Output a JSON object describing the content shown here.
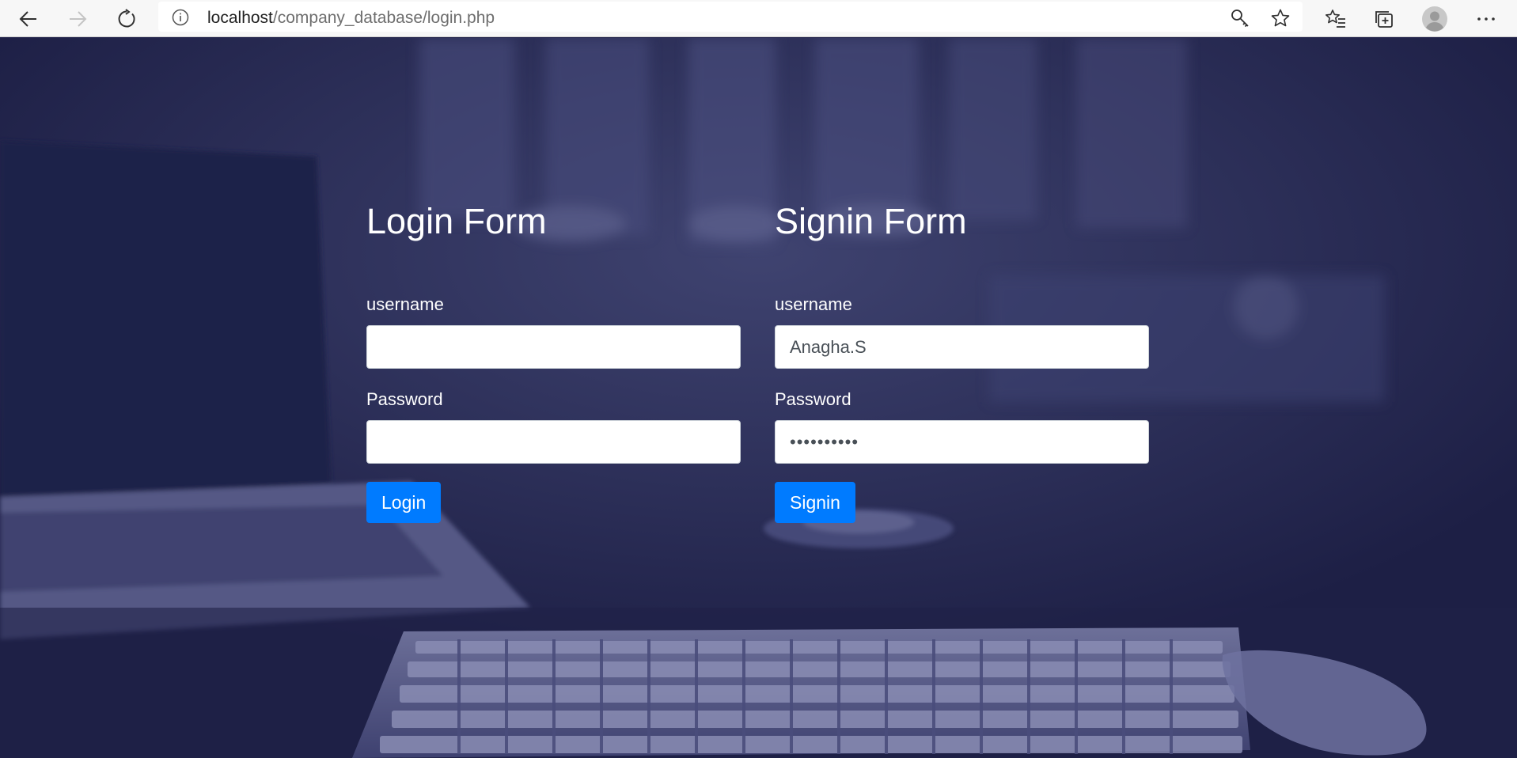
{
  "browser": {
    "url_host": "localhost",
    "url_path": "/company_database/login.php"
  },
  "icons": {
    "back": "back-arrow-icon",
    "forward": "forward-arrow-icon",
    "refresh": "refresh-icon",
    "site_info": "info-icon",
    "key": "key-icon",
    "favorite": "star-icon",
    "favorites_list": "favorites-list-icon",
    "collections": "collections-icon",
    "profile": "profile-avatar-icon",
    "more": "more-options-icon"
  },
  "colors": {
    "page_overlay": "#20224a",
    "button": "#007bff",
    "text": "#ffffff"
  },
  "login_form": {
    "title": "Login Form",
    "username_label": "username",
    "username_value": "",
    "password_label": "Password",
    "password_value": "",
    "button_label": "Login"
  },
  "signin_form": {
    "title": "Signin Form",
    "username_label": "username",
    "username_value": "Anagha.S",
    "password_label": "Password",
    "password_value": "••••••••••",
    "button_label": "Signin"
  }
}
